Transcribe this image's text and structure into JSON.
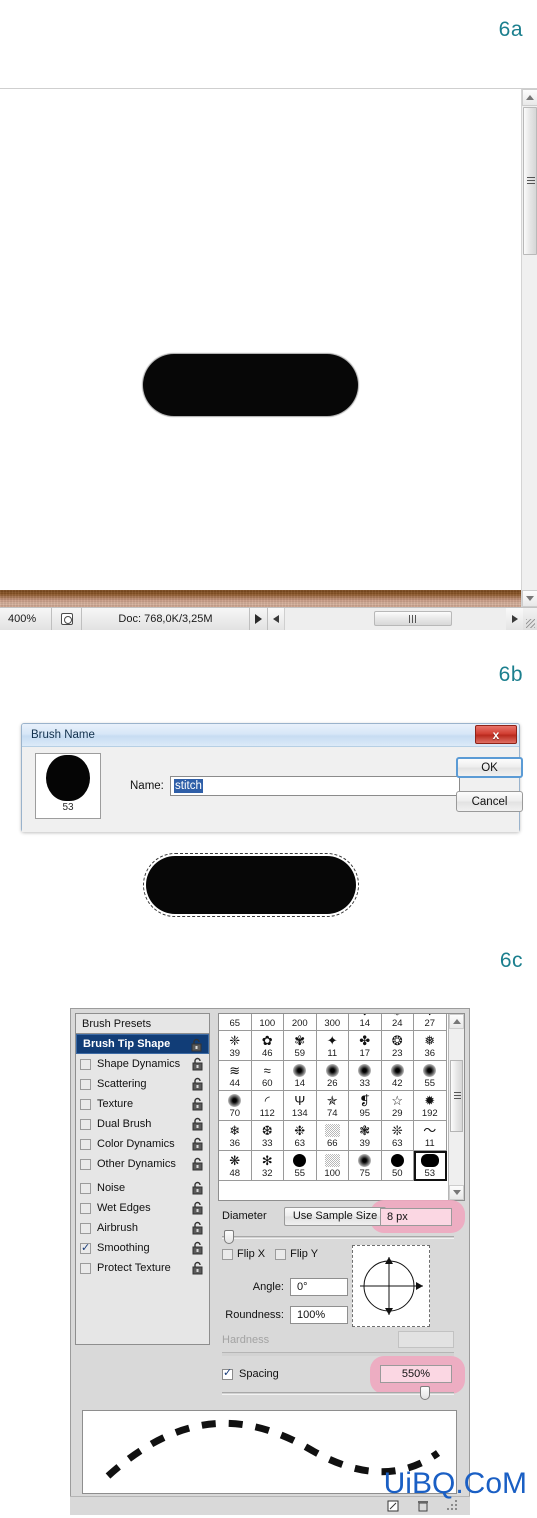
{
  "steps": {
    "a": "6a",
    "b": "6b",
    "c": "6c"
  },
  "watermark": "UiBQ.CoM",
  "panel_6a": {
    "statusbar": {
      "zoom": "400%",
      "doc_info": "Doc: 768,0K/3,25M",
      "proxy_icon": "document-proxy-icon",
      "play_icon": "play-triangle-icon",
      "left_arrow_icon": "scroll-left-icon",
      "right_arrow_icon": "scroll-right-icon",
      "resize_grip_icon": "resize-grip-icon"
    },
    "scrollbar": {
      "up_icon": "scroll-up-icon",
      "down_icon": "scroll-down-icon",
      "thumb_grip_icon": "scroll-thumb-grip-icon"
    }
  },
  "panel_6b": {
    "title": "Brush Name",
    "close_label": "x",
    "thumb_number": "53",
    "name_label": "Name:",
    "name_value": "stitch",
    "ok_label": "OK",
    "cancel_label": "Cancel"
  },
  "panel_6c": {
    "presets_header": "Brush Presets",
    "options": [
      {
        "label": "Brush Tip Shape",
        "checked": false,
        "selected": true,
        "lock": true
      },
      {
        "label": "Shape Dynamics",
        "checked": false,
        "selected": false,
        "lock": true
      },
      {
        "label": "Scattering",
        "checked": false,
        "selected": false,
        "lock": true
      },
      {
        "label": "Texture",
        "checked": false,
        "selected": false,
        "lock": true
      },
      {
        "label": "Dual Brush",
        "checked": false,
        "selected": false,
        "lock": true
      },
      {
        "label": "Color Dynamics",
        "checked": false,
        "selected": false,
        "lock": true
      },
      {
        "label": "Other Dynamics",
        "checked": false,
        "selected": false,
        "lock": true
      }
    ],
    "options2": [
      {
        "label": "Noise",
        "checked": false,
        "lock": true
      },
      {
        "label": "Wet Edges",
        "checked": false,
        "lock": true
      },
      {
        "label": "Airbrush",
        "checked": false,
        "lock": true
      },
      {
        "label": "Smoothing",
        "checked": true,
        "lock": true
      },
      {
        "label": "Protect Texture",
        "checked": false,
        "lock": true
      }
    ],
    "brush_grid": [
      {
        "size": "65",
        "glyph": "▬",
        "kind": "flat"
      },
      {
        "size": "100",
        "glyph": "▬",
        "kind": "flat"
      },
      {
        "size": "200",
        "glyph": "▬",
        "kind": "flat"
      },
      {
        "size": "300",
        "glyph": "▬",
        "kind": "flat"
      },
      {
        "size": "14",
        "glyph": "✻",
        "kind": "spatter"
      },
      {
        "size": "24",
        "glyph": "❁",
        "kind": "spatter"
      },
      {
        "size": "27",
        "glyph": "❋",
        "kind": "spatter"
      },
      {
        "size": "39",
        "glyph": "❈",
        "kind": "spatter"
      },
      {
        "size": "46",
        "glyph": "✿",
        "kind": "spatter"
      },
      {
        "size": "59",
        "glyph": "✾",
        "kind": "spatter"
      },
      {
        "size": "11",
        "glyph": "✦",
        "kind": "chalk"
      },
      {
        "size": "17",
        "glyph": "✤",
        "kind": "chalk"
      },
      {
        "size": "23",
        "glyph": "❂",
        "kind": "chalk"
      },
      {
        "size": "36",
        "glyph": "❅",
        "kind": "chalk"
      },
      {
        "size": "44",
        "glyph": "≋",
        "kind": "chalk"
      },
      {
        "size": "60",
        "glyph": "≈",
        "kind": "chalk"
      },
      {
        "size": "14",
        "glyph": "·",
        "kind": "soft"
      },
      {
        "size": "26",
        "glyph": "•",
        "kind": "soft"
      },
      {
        "size": "33",
        "glyph": "✳",
        "kind": "soft"
      },
      {
        "size": "42",
        "glyph": "✴",
        "kind": "soft"
      },
      {
        "size": "55",
        "glyph": "✶",
        "kind": "soft"
      },
      {
        "size": "70",
        "glyph": "✵",
        "kind": "soft"
      },
      {
        "size": "112",
        "glyph": "◜",
        "kind": "stroke"
      },
      {
        "size": "134",
        "glyph": "Ψ",
        "kind": "grass"
      },
      {
        "size": "74",
        "glyph": "✯",
        "kind": "leaf"
      },
      {
        "size": "95",
        "glyph": "❡",
        "kind": "leaf"
      },
      {
        "size": "29",
        "glyph": "☆",
        "kind": "star"
      },
      {
        "size": "192",
        "glyph": "✹",
        "kind": "star"
      },
      {
        "size": "36",
        "glyph": "❄",
        "kind": "spatter"
      },
      {
        "size": "33",
        "glyph": "❆",
        "kind": "spatter"
      },
      {
        "size": "63",
        "glyph": "❉",
        "kind": "spatter"
      },
      {
        "size": "66",
        "glyph": "░",
        "kind": "noise"
      },
      {
        "size": "39",
        "glyph": "❃",
        "kind": "spatter"
      },
      {
        "size": "63",
        "glyph": "❊",
        "kind": "spatter"
      },
      {
        "size": "11",
        "glyph": "～",
        "kind": "stroke"
      },
      {
        "size": "48",
        "glyph": "❋",
        "kind": "spatter"
      },
      {
        "size": "32",
        "glyph": "✻",
        "kind": "spatter"
      },
      {
        "size": "55",
        "glyph": "●",
        "kind": "hard"
      },
      {
        "size": "100",
        "glyph": "▒",
        "kind": "noise"
      },
      {
        "size": "75",
        "glyph": "◉",
        "kind": "soft"
      },
      {
        "size": "50",
        "glyph": "●",
        "kind": "hard"
      },
      {
        "size": "53",
        "glyph": "▬",
        "kind": "stitch",
        "selected": true
      }
    ],
    "diameter_label": "Diameter",
    "use_sample_size_label": "Use Sample Size",
    "diameter_value": "8 px",
    "flip_x_label": "Flip X",
    "flip_y_label": "Flip Y",
    "angle_label": "Angle:",
    "angle_value": "0°",
    "roundness_label": "Roundness:",
    "roundness_value": "100%",
    "hardness_label": "Hardness",
    "hardness_value": "",
    "spacing_label": "Spacing",
    "spacing_value": "550%",
    "footer_icons": [
      "new-brush-icon",
      "trash-icon",
      "resize-grip-icon"
    ],
    "highlight_color": "#efa9c0"
  }
}
